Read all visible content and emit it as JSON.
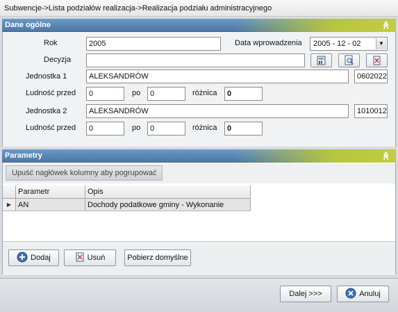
{
  "breadcrumb": "Subwencje->Lista  podziałów  realizacja->Realizacja  podziału  administracyjnego",
  "general": {
    "title": "Dane ogólne",
    "collapse_glyph": "≫",
    "rok_label": "Rok",
    "rok_value": "2005",
    "date_label": "Data wprowadzenia",
    "date_value": "2005 - 12 - 02",
    "decyzja_label": "Decyzja",
    "decyzja_value": "",
    "jednostka1_label": "Jednostka 1",
    "jednostka1_value": "ALEKSANDRÓW",
    "jednostka1_code": "0602022",
    "ludnosc1_label": "Ludność przed",
    "ludnosc1_przed": "0",
    "po1_label": "po",
    "ludnosc1_po": "0",
    "roznica1_label": "różnica",
    "roznica1_value": "0",
    "jednostka2_label": "Jednostka 2",
    "jednostka2_value": "ALEKSANDRÓW",
    "jednostka2_code": "1010012",
    "ludnosc2_label": "Ludność przed",
    "ludnosc2_przed": "0",
    "po2_label": "po",
    "ludnosc2_po": "0",
    "roznica2_label": "różnica",
    "roznica2_value": "0"
  },
  "params": {
    "title": "Parametry",
    "collapse_glyph": "≫",
    "group_hint": "Upuść nagłówek kolumny aby pogrupować",
    "columns": [
      "Parametr",
      "Opis"
    ],
    "rows": [
      {
        "parametr": "AN",
        "opis": "Dochody podatkowe gminy - Wykonanie"
      }
    ],
    "add_label": "Dodaj",
    "delete_label": "Usuń",
    "defaults_label": "Pobierz domyślne"
  },
  "footer": {
    "next_label": "Dalej >>>",
    "cancel_label": "Anuluj"
  }
}
